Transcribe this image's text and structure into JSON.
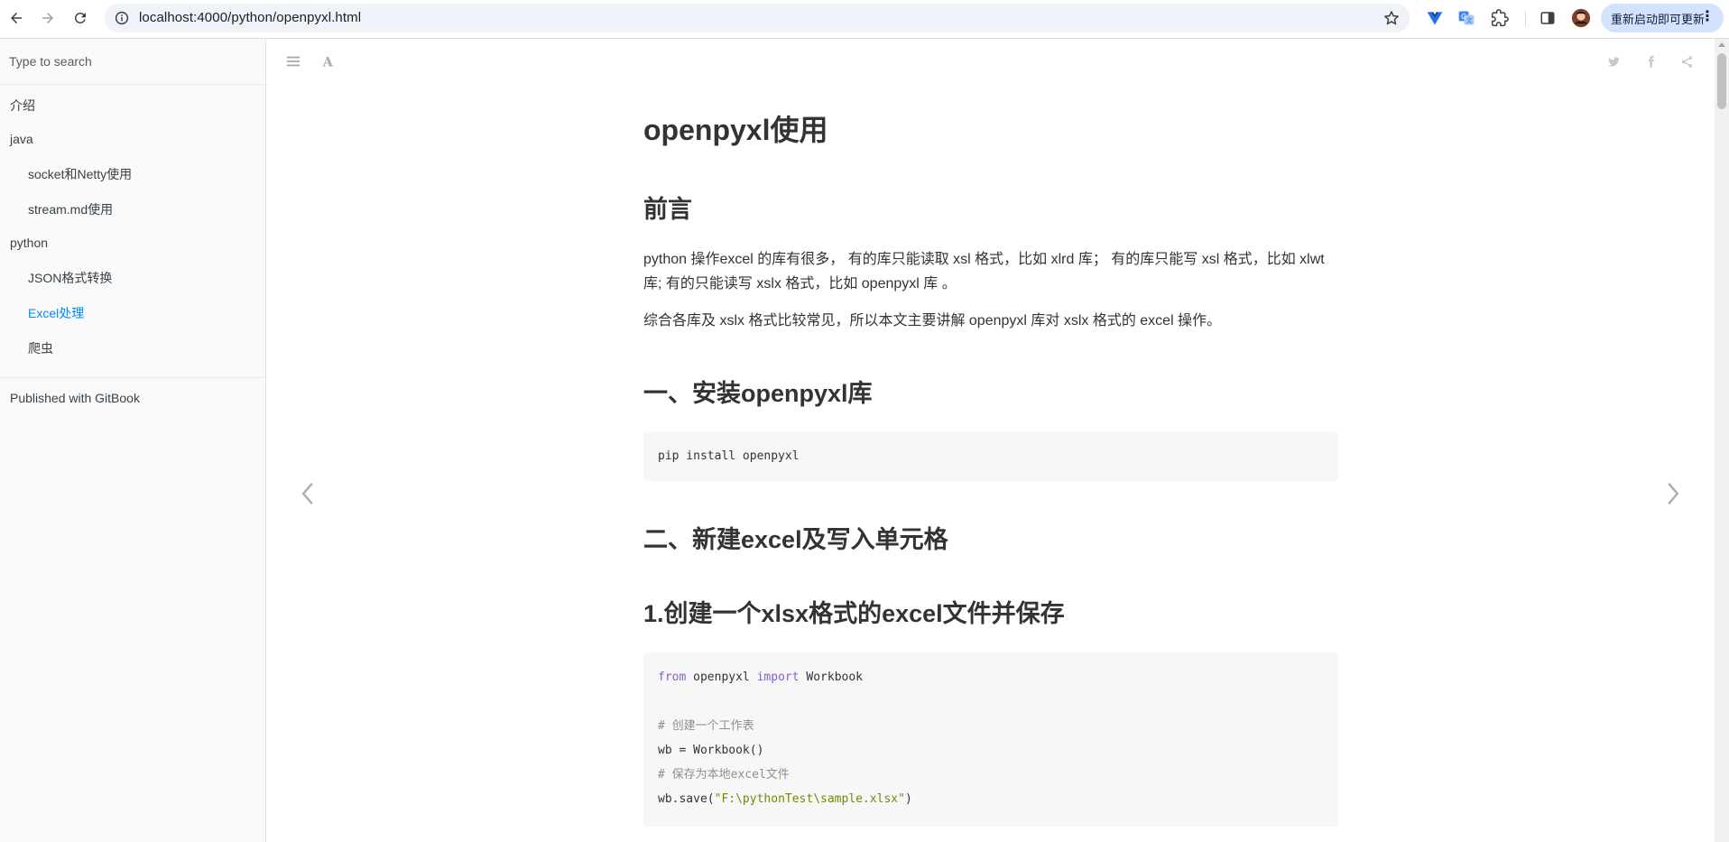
{
  "browser": {
    "url": "localhost:4000/python/openpyxl.html",
    "update_button_label": "重新启动即可更新",
    "update_menu_glyph": "⋮",
    "icons": [
      "back-icon",
      "forward-icon",
      "reload-icon",
      "site-info-icon",
      "bookmark-star-icon",
      "vue-devtools-icon",
      "translate-icon",
      "extensions-icon",
      "side-panel-icon",
      "profile-avatar"
    ]
  },
  "sidebar": {
    "search_placeholder": "Type to search",
    "items": [
      {
        "label": "介绍",
        "level": 1,
        "active": false
      },
      {
        "label": "java",
        "level": 1,
        "active": false
      },
      {
        "label": "socket和Netty使用",
        "level": 2,
        "active": false
      },
      {
        "label": "stream.md使用",
        "level": 2,
        "active": false
      },
      {
        "label": "python",
        "level": 1,
        "active": false
      },
      {
        "label": "JSON格式转换",
        "level": 2,
        "active": false
      },
      {
        "label": "Excel处理",
        "level": 2,
        "active": true
      },
      {
        "label": "爬虫",
        "level": 2,
        "active": false
      }
    ],
    "published": "Published with GitBook"
  },
  "header": {
    "icons": [
      "toggle-summary-icon",
      "font-settings-icon",
      "twitter-icon",
      "facebook-icon",
      "share-icon"
    ]
  },
  "content": {
    "title": "openpyxl使用",
    "preface_heading": "前言",
    "preface_p1": "python 操作excel 的库有很多， 有的库只能读取 xsl 格式，比如 xlrd 库； 有的库只能写 xsl 格式，比如 xlwt 库; 有的只能读写 xslx 格式，比如 openpyxl 库 。",
    "preface_p2": "综合各库及 xslx 格式比较常见，所以本文主要讲解 openpyxl 库对 xslx 格式的 excel 操作。",
    "section1_heading": "一、安装openpyxl库",
    "install_code": "pip install openpyxl",
    "section2_heading": "二、新建excel及写入单元格",
    "sub1_heading": "1.创建一个xlsx格式的excel文件并保存",
    "code2": {
      "kw_from": "from",
      "module": " openpyxl ",
      "kw_import": "import",
      "name": " Workbook",
      "comment1": "# 创建一个工作表",
      "line_wb": "wb = Workbook()",
      "comment2": "# 保存为本地excel文件",
      "save_prefix": "wb.save(",
      "save_str": "\"F:\\pythonTest\\sample.xlsx\"",
      "save_suffix": ")"
    }
  },
  "colors": {
    "sidebar_bg": "#fafafa",
    "active_link": "#008cff",
    "code_bg": "#f7f7f7",
    "keyword": "#8b5cc8",
    "comment": "#8e908c",
    "string": "#718c00",
    "update_button_bg": "#d3e3fd"
  }
}
